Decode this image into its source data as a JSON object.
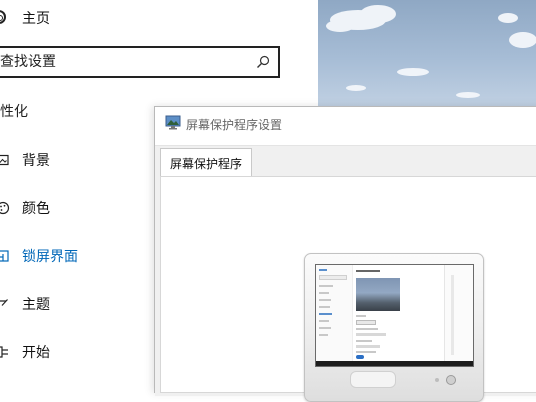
{
  "settings": {
    "home_label": "主页",
    "search_placeholder": "查找设置",
    "section_title": "性化",
    "nav_items": [
      {
        "label": "背景",
        "icon": "image-icon"
      },
      {
        "label": "颜色",
        "icon": "palette-icon"
      },
      {
        "label": "锁屏界面",
        "icon": "lock-screen-icon",
        "active": true
      },
      {
        "label": "主题",
        "icon": "brush-icon"
      },
      {
        "label": "开始",
        "icon": "start-icon"
      }
    ],
    "accent_color": "#0067b8"
  },
  "dialog": {
    "title": "屏幕保护程序设置",
    "tab_label": "屏幕保护程序"
  }
}
